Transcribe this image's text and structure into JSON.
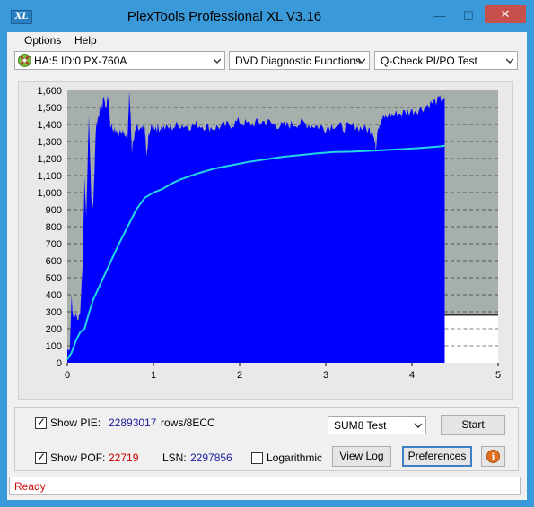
{
  "window": {
    "title": "PlexTools Professional XL V3.16",
    "icon_text": "XL",
    "minimize_glyph": "—",
    "maximize_glyph": "☐",
    "close_glyph": "✕"
  },
  "menu": {
    "options": "Options",
    "help": "Help"
  },
  "toolbar": {
    "drive": "HA:5 ID:0  PX-760A",
    "function": "DVD Diagnostic Functions",
    "test": "Q-Check PI/PO Test"
  },
  "chart_data": {
    "type": "area",
    "xlim": [
      0,
      5
    ],
    "ylim": [
      0,
      1600
    ],
    "x_ticks": [
      "0",
      "1",
      "2",
      "3",
      "4",
      "5"
    ],
    "y_ticks": [
      "0",
      "100",
      "200",
      "300",
      "400",
      "500",
      "600",
      "700",
      "800",
      "900",
      "1,000",
      "1,100",
      "1,200",
      "1,300",
      "1,400",
      "1,500",
      "1,600"
    ],
    "plot_bg": "#a6afaa",
    "pie_color": "#0000ff",
    "cumulative_color": "#22d6e2",
    "data_end_x": 4.38,
    "marker_line_y": 280,
    "pie_envelope": {
      "x": [
        0.0,
        0.03,
        0.05,
        0.06,
        0.08,
        0.1,
        0.12,
        0.15,
        0.18,
        0.2,
        0.22,
        0.25,
        0.28,
        0.3,
        0.33,
        0.35,
        0.38,
        0.4,
        0.42,
        0.45,
        0.48,
        0.5,
        0.55,
        0.6,
        0.65,
        0.7,
        0.72,
        0.75,
        0.8,
        0.85,
        0.9,
        0.92,
        0.95,
        1.0,
        1.05,
        1.1,
        1.2,
        1.3,
        1.4,
        1.5,
        1.6,
        1.7,
        1.8,
        1.9,
        2.0,
        2.1,
        2.2,
        2.3,
        2.4,
        2.5,
        2.6,
        2.7,
        2.8,
        2.9,
        3.0,
        3.1,
        3.2,
        3.3,
        3.4,
        3.5,
        3.55,
        3.58,
        3.6,
        3.65,
        3.7,
        3.8,
        3.9,
        4.0,
        4.1,
        4.2,
        4.3,
        4.38
      ],
      "y": [
        80,
        80,
        400,
        300,
        260,
        290,
        250,
        300,
        600,
        1100,
        850,
        1450,
        950,
        900,
        1370,
        1430,
        1480,
        1500,
        1550,
        1520,
        1560,
        1400,
        1380,
        1360,
        1340,
        1350,
        1600,
        1250,
        1380,
        1360,
        1380,
        1200,
        1360,
        1390,
        1380,
        1380,
        1380,
        1400,
        1390,
        1400,
        1390,
        1380,
        1390,
        1400,
        1420,
        1400,
        1410,
        1420,
        1400,
        1390,
        1400,
        1410,
        1400,
        1390,
        1380,
        1400,
        1380,
        1390,
        1380,
        1370,
        1360,
        1250,
        1380,
        1430,
        1450,
        1460,
        1470,
        1480,
        1490,
        1520,
        1540,
        1560
      ]
    },
    "cumulative": {
      "x": [
        0.0,
        0.05,
        0.1,
        0.15,
        0.2,
        0.25,
        0.3,
        0.4,
        0.5,
        0.6,
        0.7,
        0.8,
        0.9,
        1.0,
        1.1,
        1.2,
        1.3,
        1.5,
        1.7,
        1.9,
        2.1,
        2.3,
        2.5,
        2.7,
        2.9,
        3.1,
        3.3,
        3.5,
        3.7,
        3.9,
        4.1,
        4.3,
        4.38
      ],
      "y": [
        20,
        60,
        130,
        180,
        200,
        290,
        370,
        480,
        590,
        700,
        800,
        900,
        970,
        1000,
        1020,
        1050,
        1075,
        1110,
        1140,
        1160,
        1180,
        1195,
        1210,
        1220,
        1230,
        1238,
        1240,
        1245,
        1250,
        1255,
        1262,
        1270,
        1275
      ]
    }
  },
  "stats": {
    "show_pie_label": "Show PIE:",
    "pie_value": "22893017",
    "pie_unit": "rows/8ECC",
    "show_pof_label": "Show POF:",
    "pof_value": "22719",
    "lsn_label": "LSN:",
    "lsn_value": "2297856",
    "logarithmic_label": "Logarithmic",
    "show_pie_checked": true,
    "show_pof_checked": true,
    "logarithmic_checked": false,
    "value_color": "#1d1d9a",
    "pof_color": "#cc0000"
  },
  "controls": {
    "test_select": "SUM8 Test",
    "start": "Start",
    "view_log": "View Log",
    "preferences": "Preferences",
    "info_glyph": "i"
  },
  "status": {
    "text": "Ready",
    "color": "#d01010"
  }
}
